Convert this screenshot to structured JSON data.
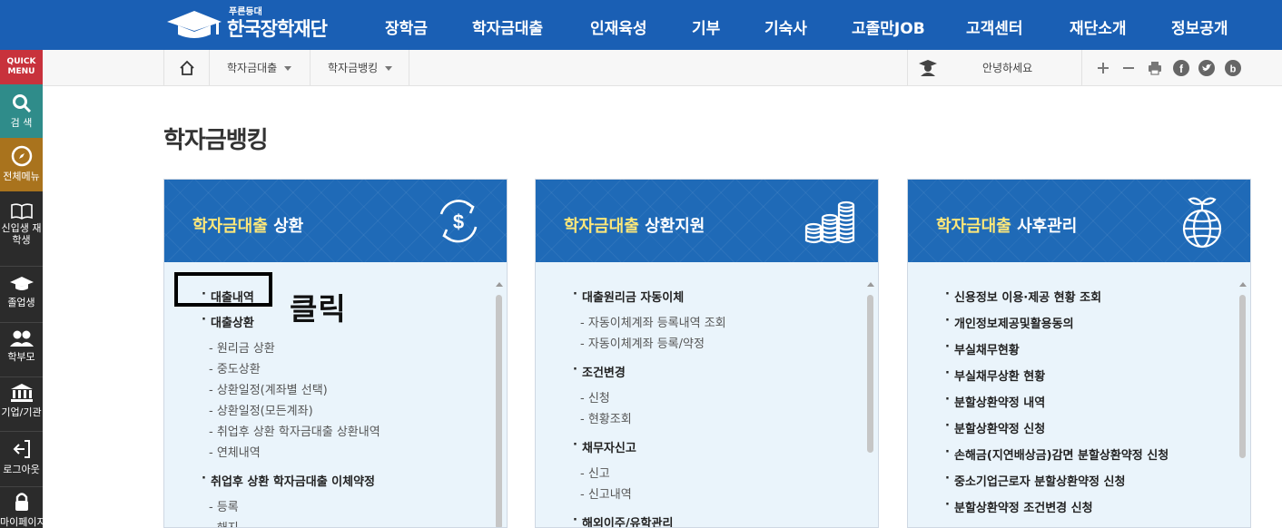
{
  "logo": {
    "sub": "푸른등대",
    "name": "한국장학재단"
  },
  "nav": [
    "장학금",
    "학자금대출",
    "인재육성",
    "기부",
    "기숙사",
    "고졸만JOB",
    "고객센터",
    "재단소개",
    "정보공개"
  ],
  "quick_menu": {
    "title": "QUICK MENU",
    "items": [
      {
        "label": "검 색",
        "icon": "search-icon"
      },
      {
        "label": "전체메뉴",
        "icon": "compass-icon"
      },
      {
        "label": "신입생 재학생",
        "icon": "book-icon"
      },
      {
        "label": "졸업생",
        "icon": "graduation-cap-icon"
      },
      {
        "label": "학부모",
        "icon": "people-icon"
      },
      {
        "label": "기업/기관",
        "icon": "bank-icon"
      },
      {
        "label": "로그아웃",
        "icon": "logout-icon"
      },
      {
        "label": "마이페이지",
        "icon": "lock-icon"
      }
    ],
    "colors": {
      "header": "#c8323c",
      "search": "#2f8c8a",
      "all_menu": "#a9731d"
    }
  },
  "breadcrumb": {
    "home_icon": "home-icon",
    "level1": "학자금대출",
    "level2": "학자금뱅킹"
  },
  "user": {
    "greeting": "안녕하세요"
  },
  "tools": [
    "plus-icon",
    "minus-icon",
    "print-icon",
    "facebook-icon",
    "twitter-icon",
    "blog-icon"
  ],
  "page_title": "학자금뱅킹",
  "cards": [
    {
      "title_main": "학자금대출",
      "title_hl": "상환",
      "icon": "dollar-cycle-icon",
      "items": [
        {
          "type": "h",
          "text": "대출내역"
        },
        {
          "type": "h",
          "text": "대출상환"
        },
        {
          "type": "s",
          "text": "원리금 상환"
        },
        {
          "type": "s",
          "text": "중도상환"
        },
        {
          "type": "s",
          "text": "상환일정(계좌별 선택)"
        },
        {
          "type": "s",
          "text": "상환일정(모든계좌)"
        },
        {
          "type": "s",
          "text": "취업후 상환 학자금대출 상환내역"
        },
        {
          "type": "s",
          "text": "연체내역"
        },
        {
          "type": "h",
          "text": "취업후 상환 학자금대출 이체약정"
        },
        {
          "type": "s",
          "text": "등록"
        },
        {
          "type": "s",
          "text": "해지"
        }
      ]
    },
    {
      "title_main": "학자금대출",
      "title_hl": "상환지원",
      "icon": "coin-stacks-icon",
      "items": [
        {
          "type": "h",
          "text": "대출원리금 자동이체"
        },
        {
          "type": "s",
          "text": "자동이체계좌 등록내역 조회"
        },
        {
          "type": "s",
          "text": "자동이체계좌 등록/약정"
        },
        {
          "type": "h",
          "text": "조건변경"
        },
        {
          "type": "s",
          "text": "신청"
        },
        {
          "type": "s",
          "text": "현황조회"
        },
        {
          "type": "h",
          "text": "채무자신고"
        },
        {
          "type": "s",
          "text": "신고"
        },
        {
          "type": "s",
          "text": "신고내역"
        },
        {
          "type": "h",
          "text": "해외이주/유학관리"
        }
      ]
    },
    {
      "title_main": "학자금대출",
      "title_hl": "사후관리",
      "icon": "globe-sprout-icon",
      "items": [
        {
          "type": "h",
          "text": "신용정보 이용·제공 현황 조회"
        },
        {
          "type": "h",
          "text": "개인정보제공및활용동의"
        },
        {
          "type": "h",
          "text": "부실채무현황"
        },
        {
          "type": "h",
          "text": "부실채무상환 현황"
        },
        {
          "type": "h",
          "text": "분할상환약정 내역"
        },
        {
          "type": "h",
          "text": "분할상환약정 신청"
        },
        {
          "type": "h",
          "text": "손해금(지연배상금)감면 분할상환약정 신청"
        },
        {
          "type": "h",
          "text": "중소기업근로자 분할상환약정 신청"
        },
        {
          "type": "h",
          "text": "분할상환약정 조건변경 신청"
        }
      ]
    }
  ],
  "annotation": {
    "label": "클릭"
  },
  "colors": {
    "nav_bg": "#1a5fb4",
    "card_head": "#1f6ab7",
    "highlight": "#fde779",
    "list_bg": "#eaf4fb"
  }
}
